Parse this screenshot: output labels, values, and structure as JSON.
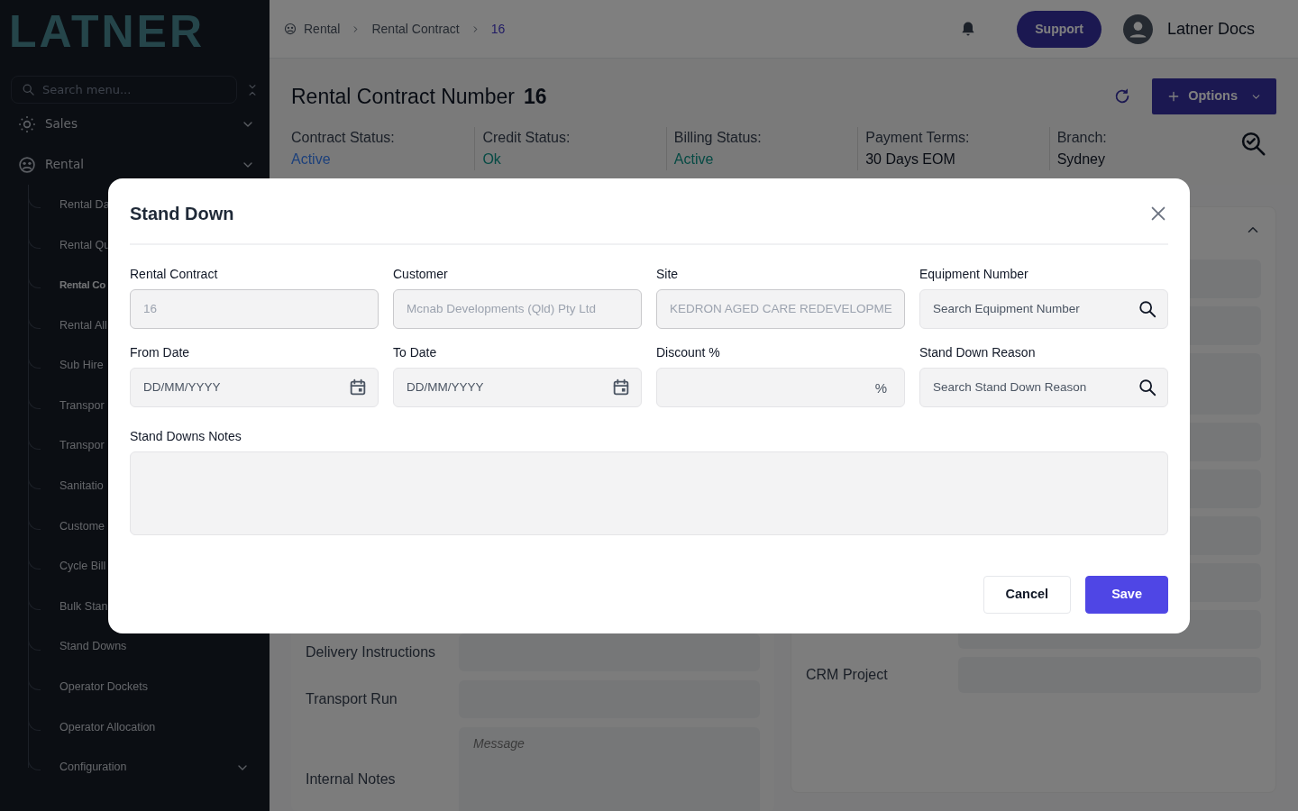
{
  "sidebar": {
    "logo": "LATNER",
    "search": {
      "placeholder": "Search menu..."
    },
    "items": [
      {
        "label": "Sales"
      },
      {
        "label": "Rental",
        "children": [
          {
            "label": "Rental Da",
            "kind": "link",
            "selected": false
          },
          {
            "label": "Rental Qu",
            "kind": "link",
            "selected": false
          },
          {
            "label": "Rental Co",
            "kind": "link",
            "selected": true
          },
          {
            "label": "Rental All",
            "kind": "link",
            "selected": false
          },
          {
            "label": "Sub Hire",
            "kind": "link",
            "selected": false
          },
          {
            "label": "Transpor",
            "kind": "link",
            "selected": false
          },
          {
            "label": "Transpor",
            "kind": "link",
            "selected": false
          },
          {
            "label": "Sanitatio",
            "kind": "link",
            "selected": false
          },
          {
            "label": "Custome",
            "kind": "link",
            "selected": false
          },
          {
            "label": "Cycle Bill",
            "kind": "link",
            "selected": false
          },
          {
            "label": "Bulk Stan",
            "kind": "link",
            "selected": false
          },
          {
            "label": "Stand Downs",
            "kind": "link",
            "selected": false
          },
          {
            "label": "Operator Dockets",
            "kind": "link",
            "selected": false
          },
          {
            "label": "Operator Allocation",
            "kind": "link",
            "selected": false
          },
          {
            "label": "Configuration",
            "kind": "group",
            "selected": false
          }
        ]
      }
    ]
  },
  "breadcrumb": [
    {
      "label": "Rental",
      "selected": false
    },
    {
      "label": "Rental Contract",
      "selected": false
    },
    {
      "label": "16",
      "selected": true
    }
  ],
  "topbar": {
    "support": "Support",
    "user": "Latner Docs"
  },
  "header": {
    "title": "Rental Contract Number",
    "number": "16",
    "options": "Options",
    "statuses": [
      {
        "label": "Contract Status:",
        "value": "Active",
        "kind": "info"
      },
      {
        "label": "Credit Status:",
        "value": "Ok",
        "kind": "success"
      },
      {
        "label": "Billing Status:",
        "value": "Active",
        "kind": "success"
      },
      {
        "label": "Payment Terms:",
        "value": "30 Days EOM",
        "kind": "plain"
      },
      {
        "label": "Branch:",
        "value": "Sydney",
        "kind": "plain"
      }
    ]
  },
  "details": {
    "left_rows": [
      {
        "label": "Delivery Instructions",
        "kind": "input"
      },
      {
        "label": "Transport Run",
        "kind": "input"
      },
      {
        "label": "Internal Notes",
        "kind": "textarea",
        "placeholder": "Message"
      }
    ],
    "right_rows": [
      {
        "label": "CRM Project"
      }
    ]
  },
  "modal": {
    "title": "Stand Down",
    "fields": [
      {
        "label": "Rental Contract",
        "kind": "text",
        "value": "16",
        "disabled": true
      },
      {
        "label": "Customer",
        "kind": "text",
        "value": "Mcnab Developments (Qld) Pty Ltd",
        "disabled": true
      },
      {
        "label": "Site",
        "kind": "text",
        "value": "KEDRON AGED CARE REDEVELOPME",
        "disabled": true
      },
      {
        "label": "Equipment Number",
        "kind": "search",
        "placeholder": "Search Equipment Number",
        "disabled": false
      },
      {
        "label": "From Date",
        "kind": "date",
        "placeholder": "DD/MM/YYYY",
        "disabled": false
      },
      {
        "label": "To Date",
        "kind": "date",
        "placeholder": "DD/MM/YYYY",
        "disabled": false
      },
      {
        "label": "Discount %",
        "kind": "percent",
        "suffix": "%",
        "disabled": false
      },
      {
        "label": "Stand Down Reason",
        "kind": "search",
        "placeholder": "Search Stand Down Reason",
        "disabled": false
      }
    ],
    "notes": {
      "label": "Stand Downs Notes"
    },
    "buttons": [
      {
        "label": "Cancel",
        "kind": "secondary"
      },
      {
        "label": "Save",
        "kind": "primary"
      }
    ]
  }
}
